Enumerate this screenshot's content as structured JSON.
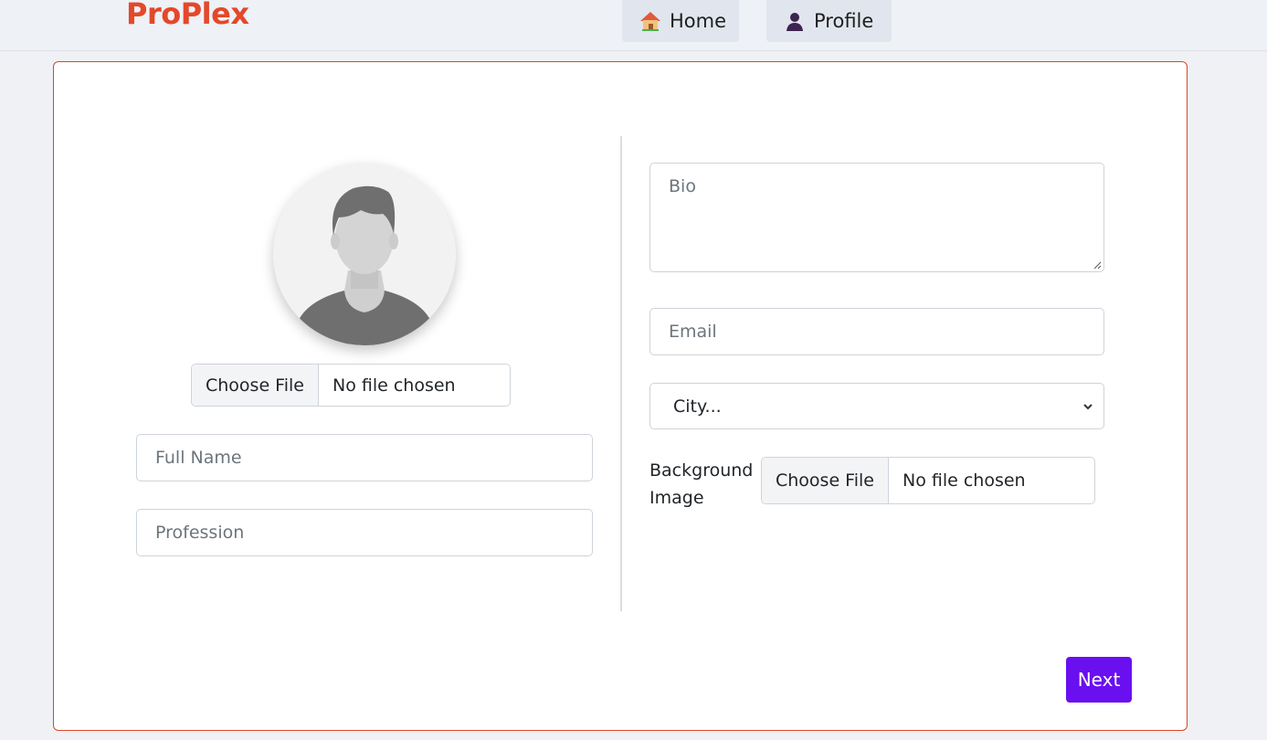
{
  "navbar": {
    "brand": "ProPlex",
    "items": [
      {
        "label": "Home",
        "icon": "home-icon"
      },
      {
        "label": "Profile",
        "icon": "user-icon"
      }
    ]
  },
  "form": {
    "avatar_file": {
      "button_label": "Choose File",
      "status": "No file chosen"
    },
    "full_name_placeholder": "Full Name",
    "profession_placeholder": "Profession",
    "bio_placeholder": "Bio",
    "email_placeholder": "Email",
    "city_selected": "City...",
    "background_label": "Background Image",
    "background_file": {
      "button_label": "Choose File",
      "status": "No file chosen"
    },
    "next_label": "Next"
  },
  "colors": {
    "brand": "#e4482a",
    "accent": "#6a0ff0",
    "card_border": "#d9472b"
  }
}
